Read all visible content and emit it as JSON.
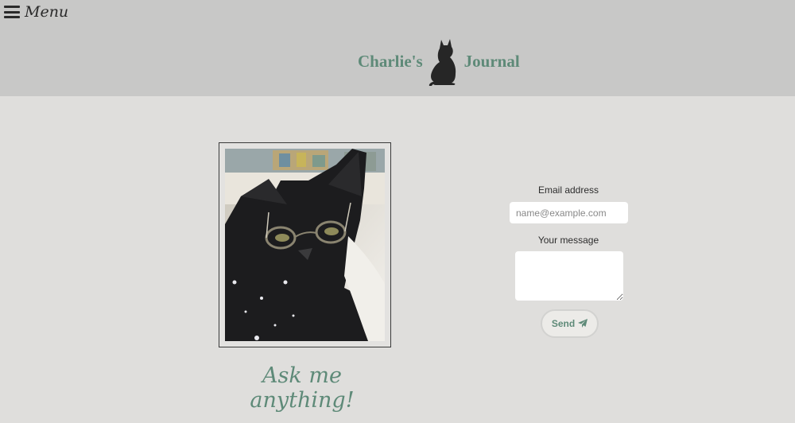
{
  "header": {
    "menu_label": "Menu",
    "brand_left": "Charlie's",
    "brand_right": "Journal",
    "brand_icon": "black-cat-icon"
  },
  "main": {
    "photo_icon": "cat-with-glasses-photo",
    "tagline": "Ask me anything!"
  },
  "form": {
    "email_label": "Email address",
    "email_placeholder": "name@example.com",
    "message_label": "Your message",
    "send_label": "Send",
    "send_icon": "paper-plane-icon"
  },
  "colors": {
    "accent": "#5e8a78",
    "header_bg": "#c8c8c7",
    "page_bg": "#dfdedc"
  }
}
